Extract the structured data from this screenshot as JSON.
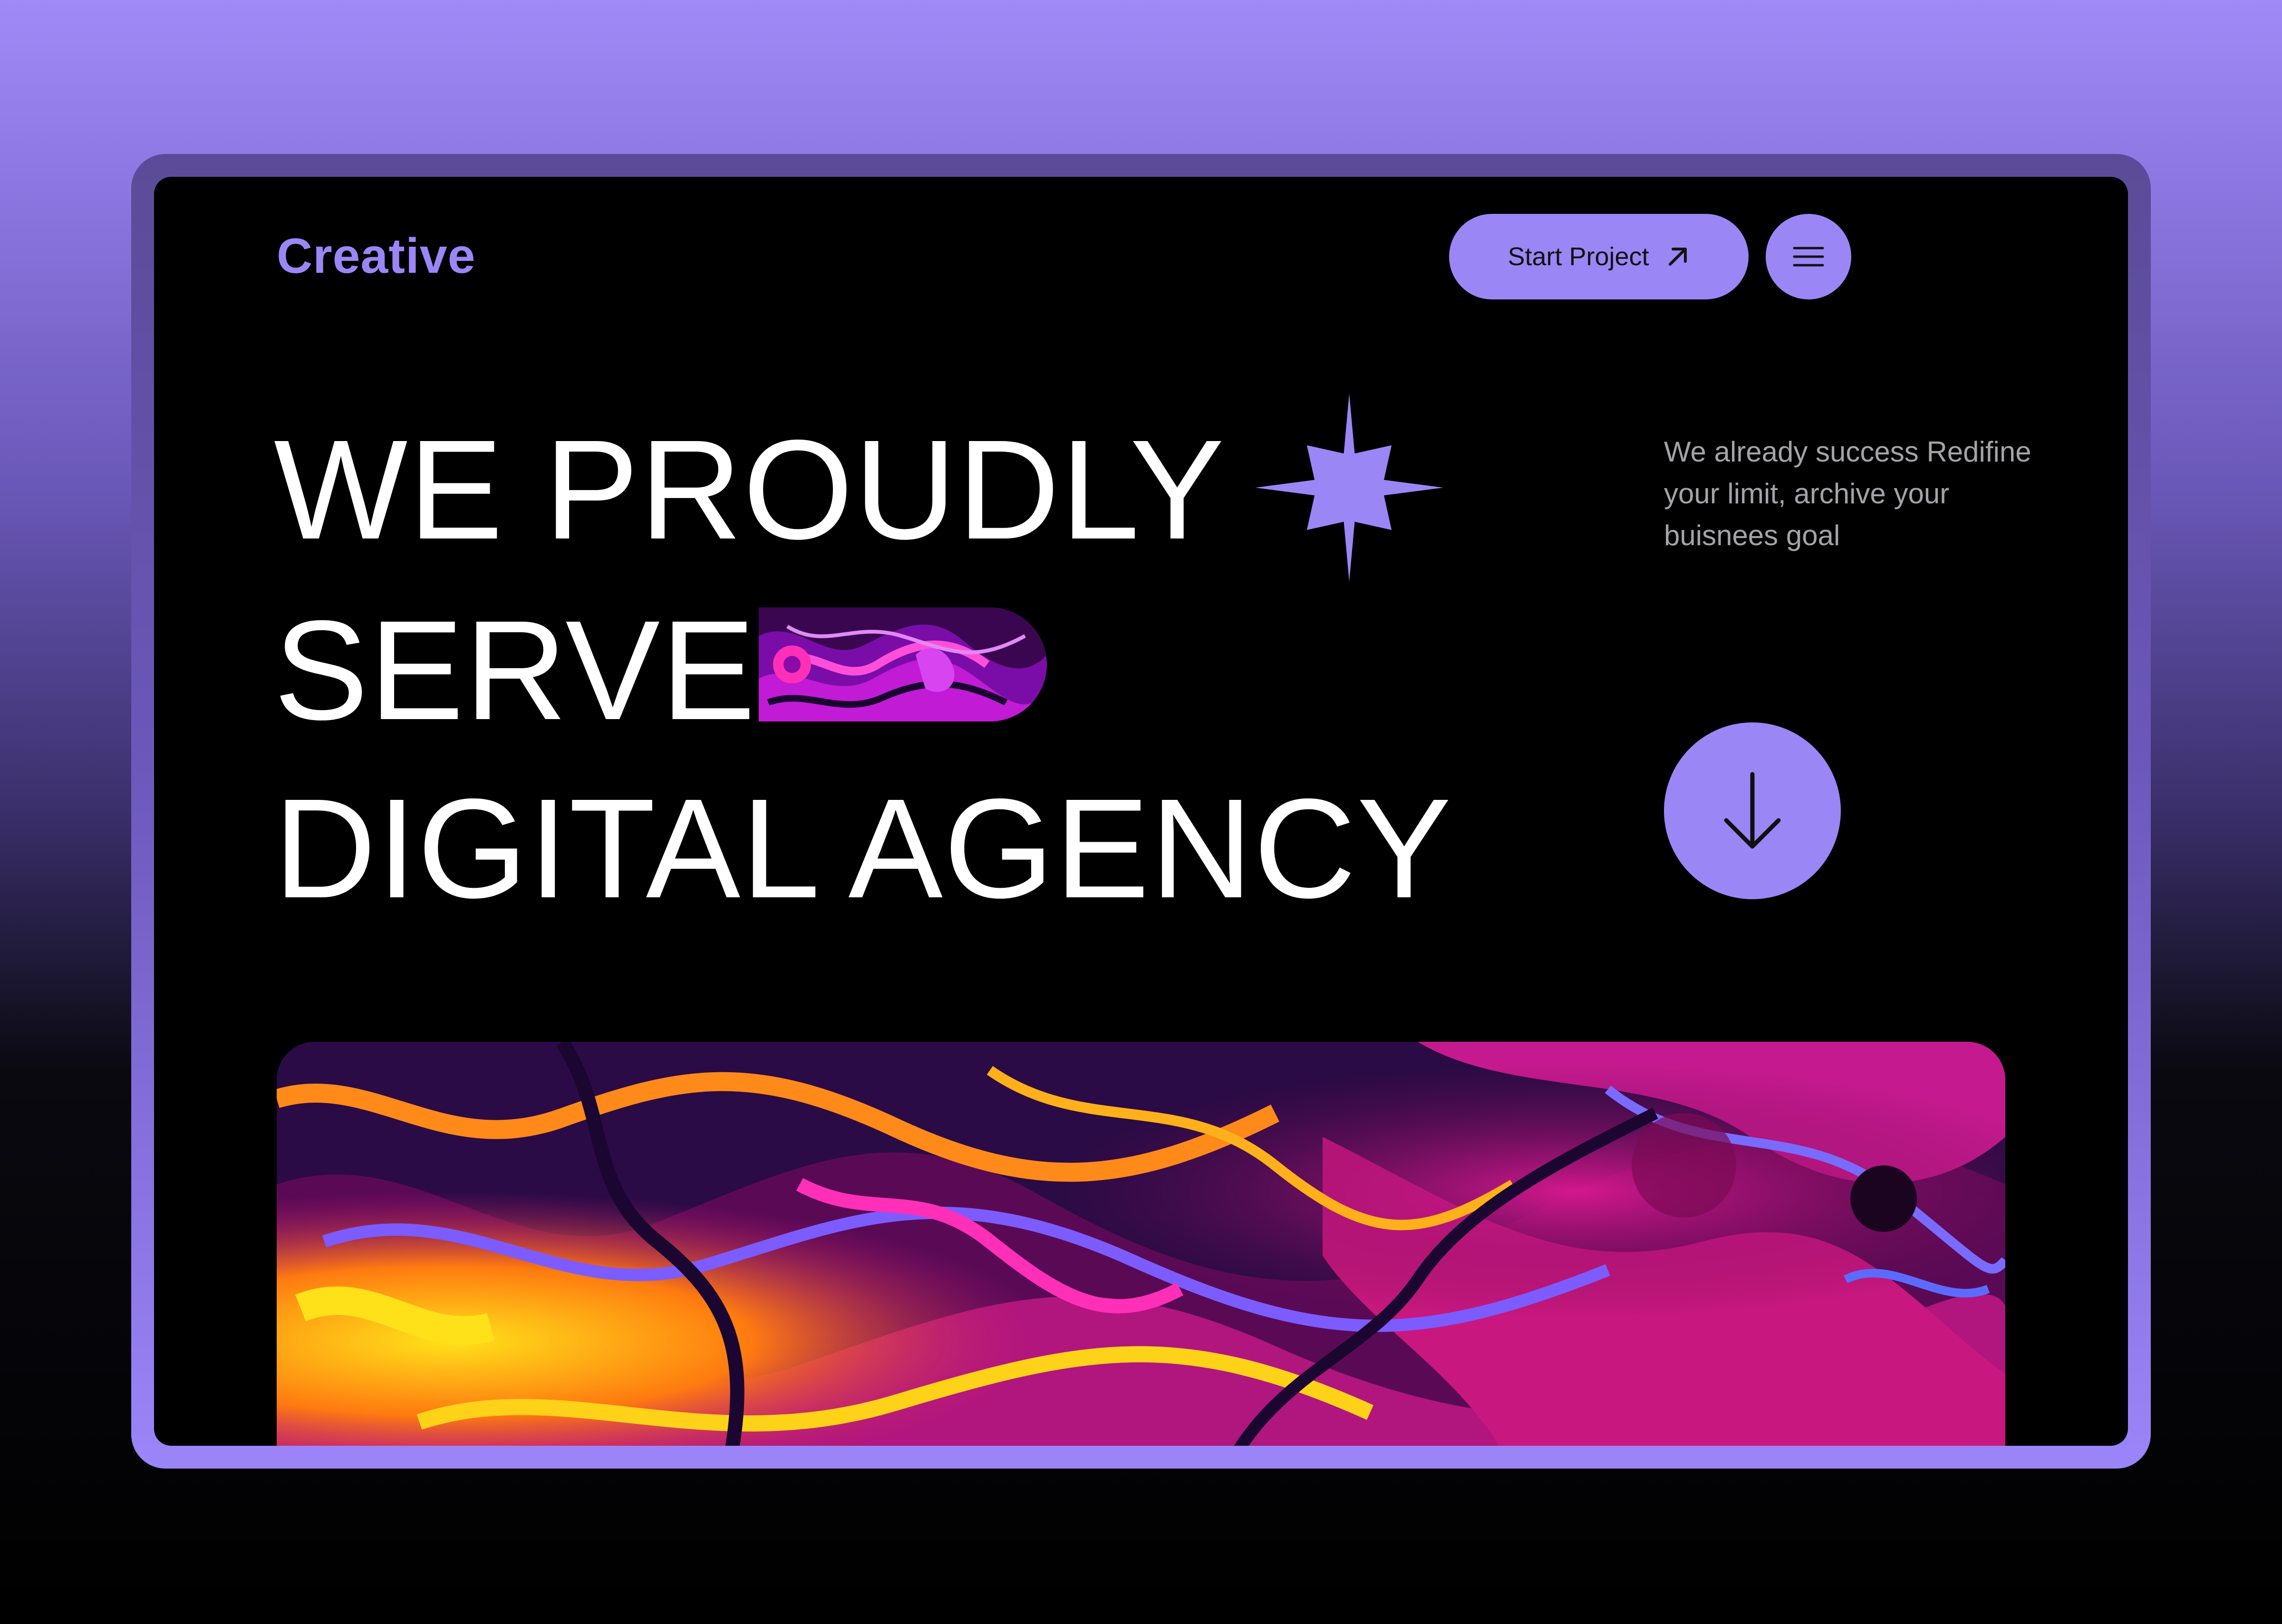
{
  "brand": {
    "name": "Creative",
    "accent_color": "#9b86f6"
  },
  "header": {
    "cta_label": "Start Project",
    "cta_icon": "arrow-up-right-icon",
    "menu_icon": "hamburger-menu-icon"
  },
  "hero": {
    "headline_lines": [
      "WE PROUDLY",
      "SERVE",
      "DIGITAL AGENCY"
    ],
    "star_icon": "four-point-star-icon",
    "tagline": "We already success Redifine your limit, archive your buisnees goal",
    "scroll_icon": "arrow-down-icon"
  }
}
